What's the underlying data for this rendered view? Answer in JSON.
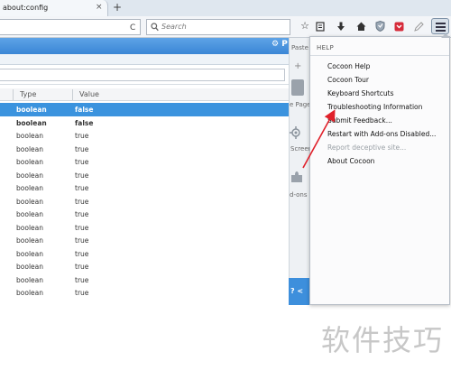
{
  "tab": {
    "title": "about:config",
    "close_glyph": "×",
    "new_tab_glyph": "+"
  },
  "navbar": {
    "reload_glyph": "C",
    "search_placeholder": "Search",
    "toolbar_icons": [
      "star-icon",
      "reading-list-icon",
      "download-icon",
      "home-icon",
      "shield-icon",
      "pocket-icon",
      "edit-icon",
      "menu-icon"
    ]
  },
  "page": {
    "header_right_label": "P",
    "columns": {
      "type": "Type",
      "value": "Value"
    },
    "rows": [
      {
        "type": "boolean",
        "value": "false",
        "selected": true,
        "bold": true
      },
      {
        "type": "boolean",
        "value": "false",
        "selected": false,
        "bold": true
      },
      {
        "type": "boolean",
        "value": "true",
        "selected": false,
        "bold": false
      },
      {
        "type": "boolean",
        "value": "true",
        "selected": false,
        "bold": false
      },
      {
        "type": "boolean",
        "value": "true",
        "selected": false,
        "bold": false
      },
      {
        "type": "boolean",
        "value": "true",
        "selected": false,
        "bold": false
      },
      {
        "type": "boolean",
        "value": "true",
        "selected": false,
        "bold": false
      },
      {
        "type": "boolean",
        "value": "true",
        "selected": false,
        "bold": false
      },
      {
        "type": "boolean",
        "value": "true",
        "selected": false,
        "bold": false
      },
      {
        "type": "boolean",
        "value": "true",
        "selected": false,
        "bold": false
      },
      {
        "type": "boolean",
        "value": "true",
        "selected": false,
        "bold": false
      },
      {
        "type": "boolean",
        "value": "true",
        "selected": false,
        "bold": false
      },
      {
        "type": "boolean",
        "value": "true",
        "selected": false,
        "bold": false
      },
      {
        "type": "boolean",
        "value": "true",
        "selected": false,
        "bold": false
      },
      {
        "type": "boolean",
        "value": "true",
        "selected": false,
        "bold": false
      }
    ]
  },
  "customize_strip": {
    "paste": "Paste",
    "plus": "+",
    "page": "e Page",
    "screen": "Screen",
    "addons": "d-ons",
    "bottom": "? <"
  },
  "help_menu": {
    "header": "HELP",
    "items": [
      {
        "label": "Cocoon Help",
        "disabled": false
      },
      {
        "label": "Cocoon Tour",
        "disabled": false
      },
      {
        "label": "Keyboard Shortcuts",
        "disabled": false
      },
      {
        "label": "Troubleshooting Information",
        "disabled": false
      },
      {
        "label": "Submit Feedback...",
        "disabled": false
      },
      {
        "label": "Restart with Add-ons Disabled...",
        "disabled": false
      },
      {
        "label": "Report deceptive site...",
        "disabled": true
      },
      {
        "label": "About Cocoon",
        "disabled": false
      }
    ]
  },
  "watermark": "软件技巧",
  "colors": {
    "accent_blue": "#3b93de",
    "annotation_red": "#e0202a"
  }
}
